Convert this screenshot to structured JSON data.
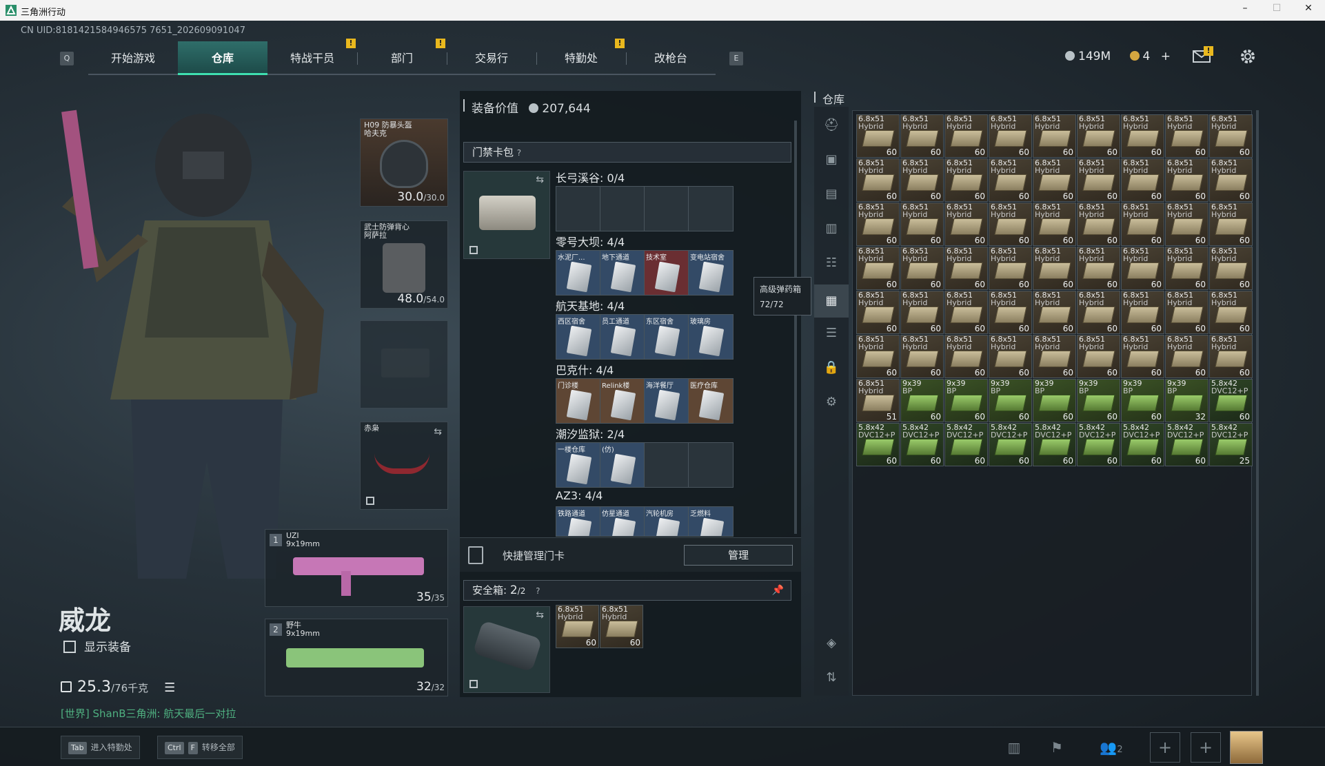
{
  "window": {
    "title": "三角洲行动",
    "minimize": "–",
    "maximize": "☐",
    "close": "✕"
  },
  "uid": "CN UID:8181421584946575 7651_202609091047",
  "nav": {
    "left_key": "Q",
    "right_key": "E",
    "tabs": [
      {
        "label": "开始游戏",
        "badge": ""
      },
      {
        "label": "仓库",
        "badge": ""
      },
      {
        "label": "特战干员",
        "badge": "!"
      },
      {
        "label": "部门",
        "badge": "!"
      },
      {
        "label": "交易行",
        "badge": ""
      },
      {
        "label": "特勤处",
        "badge": "!"
      },
      {
        "label": "改枪台",
        "badge": ""
      }
    ],
    "active_index": 1
  },
  "currency": {
    "silver": "149M",
    "gold": "4",
    "gold_plus": "+",
    "mail_badge": "!"
  },
  "character": {
    "name": "威龙",
    "show_equipment": "显示装备",
    "weight": "25.3",
    "weight_max": "/76千克"
  },
  "chat": {
    "text": "[世界] ShanB三角洲: 航天最后一对拉"
  },
  "equipment": {
    "helmet": {
      "label": "H09 防暴头盔\n哈夫克",
      "value": "30.0",
      "max": "/30.0"
    },
    "armor": {
      "label": "武士防弹背心\n阿萨拉",
      "value": "48.0",
      "max": "/54.0"
    },
    "melee": {
      "label": "赤枭"
    },
    "primary": {
      "slot": "1",
      "name": "UZI",
      "caliber": "9x19mm",
      "ammo": "35",
      "ammo_max": "/35"
    },
    "secondary": {
      "slot": "2",
      "name": "野牛",
      "caliber": "9x19mm",
      "ammo": "32",
      "ammo_max": "/32"
    }
  },
  "equip_value": {
    "label": "装备价值",
    "value": "207,644"
  },
  "keycard_pack": {
    "title": "门禁卡包",
    "help": "?",
    "groups": [
      {
        "title": "长弓溪谷: 0/4",
        "cards": []
      },
      {
        "title": "零号大坝: 4/4",
        "cards": [
          {
            "name": "水泥厂...",
            "type": "blue"
          },
          {
            "name": "地下通道",
            "type": "blue"
          },
          {
            "name": "技术室",
            "type": "red"
          },
          {
            "name": "变电站宿舍",
            "type": "blue"
          }
        ]
      },
      {
        "title": "航天基地: 4/4",
        "cards": [
          {
            "name": "西区宿舍",
            "type": "blue"
          },
          {
            "name": "员工通道",
            "type": "blue"
          },
          {
            "name": "东区宿舍",
            "type": "blue"
          },
          {
            "name": "玻璃房",
            "type": "blue"
          }
        ]
      },
      {
        "title": "巴克什: 4/4",
        "cards": [
          {
            "name": "门诊楼",
            "type": "brown"
          },
          {
            "name": "Relink楼",
            "type": "brown"
          },
          {
            "name": "海洋餐厅",
            "type": "blue"
          },
          {
            "name": "医疗仓库",
            "type": "brown"
          }
        ]
      },
      {
        "title": "潮汐监狱: 2/4",
        "cards": [
          {
            "name": "一楼仓库",
            "type": "blue"
          },
          {
            "name": "(仿)",
            "type": "blue"
          }
        ]
      },
      {
        "title": "AZ3: 4/4",
        "cards": [
          {
            "name": "铁路通道",
            "type": "blue"
          },
          {
            "name": "仿星通道",
            "type": "blue"
          },
          {
            "name": "汽轮机房",
            "type": "blue"
          },
          {
            "name": "乏燃料",
            "type": "blue"
          }
        ]
      }
    ]
  },
  "quick_manage": {
    "label": "快捷管理门卡",
    "button": "管理"
  },
  "safe_box": {
    "title": "安全箱",
    "count": "2",
    "capacity": "/2",
    "help": "?",
    "items": [
      {
        "name": "6.8x51",
        "sub": "Hybrid",
        "count": "60"
      },
      {
        "name": "6.8x51",
        "sub": "Hybrid",
        "count": "60"
      }
    ]
  },
  "tooltip": {
    "title": "高级弹药箱",
    "value": "72/72"
  },
  "warehouse": {
    "title": "仓库",
    "rows": [
      [
        {
          "n": "6.8x51",
          "s": "Hybrid",
          "c": "60",
          "t": 0
        },
        {
          "n": "6.8x51",
          "s": "Hybrid",
          "c": "60",
          "t": 0
        },
        {
          "n": "6.8x51",
          "s": "Hybrid",
          "c": "60",
          "t": 0
        },
        {
          "n": "6.8x51",
          "s": "Hybrid",
          "c": "60",
          "t": 0
        },
        {
          "n": "6.8x51",
          "s": "Hybrid",
          "c": "60",
          "t": 0
        },
        {
          "n": "6.8x51",
          "s": "Hybrid",
          "c": "60",
          "t": 0
        },
        {
          "n": "6.8x51",
          "s": "Hybrid",
          "c": "60",
          "t": 0
        },
        {
          "n": "6.8x51",
          "s": "Hybrid",
          "c": "60",
          "t": 0
        },
        {
          "n": "6.8x51",
          "s": "Hybrid",
          "c": "60",
          "t": 0
        }
      ],
      [
        {
          "n": "6.8x51",
          "s": "Hybrid",
          "c": "60",
          "t": 0
        },
        {
          "n": "6.8x51",
          "s": "Hybrid",
          "c": "60",
          "t": 0
        },
        {
          "n": "6.8x51",
          "s": "Hybrid",
          "c": "60",
          "t": 0
        },
        {
          "n": "6.8x51",
          "s": "Hybrid",
          "c": "60",
          "t": 0
        },
        {
          "n": "6.8x51",
          "s": "Hybrid",
          "c": "60",
          "t": 0
        },
        {
          "n": "6.8x51",
          "s": "Hybrid",
          "c": "60",
          "t": 0
        },
        {
          "n": "6.8x51",
          "s": "Hybrid",
          "c": "60",
          "t": 0
        },
        {
          "n": "6.8x51",
          "s": "Hybrid",
          "c": "60",
          "t": 0
        },
        {
          "n": "6.8x51",
          "s": "Hybrid",
          "c": "60",
          "t": 0
        }
      ],
      [
        {
          "n": "6.8x51",
          "s": "Hybrid",
          "c": "60",
          "t": 0
        },
        {
          "n": "6.8x51",
          "s": "Hybrid",
          "c": "60",
          "t": 0
        },
        {
          "n": "6.8x51",
          "s": "Hybrid",
          "c": "60",
          "t": 0
        },
        {
          "n": "6.8x51",
          "s": "Hybrid",
          "c": "60",
          "t": 0
        },
        {
          "n": "6.8x51",
          "s": "Hybrid",
          "c": "60",
          "t": 0
        },
        {
          "n": "6.8x51",
          "s": "Hybrid",
          "c": "60",
          "t": 0
        },
        {
          "n": "6.8x51",
          "s": "Hybrid",
          "c": "60",
          "t": 0
        },
        {
          "n": "6.8x51",
          "s": "Hybrid",
          "c": "60",
          "t": 0
        },
        {
          "n": "6.8x51",
          "s": "Hybrid",
          "c": "60",
          "t": 0
        }
      ],
      [
        {
          "n": "6.8x51",
          "s": "Hybrid",
          "c": "60",
          "t": 0
        },
        {
          "n": "6.8x51",
          "s": "Hybrid",
          "c": "60",
          "t": 0
        },
        {
          "n": "6.8x51",
          "s": "Hybrid",
          "c": "60",
          "t": 0
        },
        {
          "n": "6.8x51",
          "s": "Hybrid",
          "c": "60",
          "t": 0
        },
        {
          "n": "6.8x51",
          "s": "Hybrid",
          "c": "60",
          "t": 0
        },
        {
          "n": "6.8x51",
          "s": "Hybrid",
          "c": "60",
          "t": 0
        },
        {
          "n": "6.8x51",
          "s": "Hybrid",
          "c": "60",
          "t": 0
        },
        {
          "n": "6.8x51",
          "s": "Hybrid",
          "c": "60",
          "t": 0
        },
        {
          "n": "6.8x51",
          "s": "Hybrid",
          "c": "60",
          "t": 0
        }
      ],
      [
        {
          "n": "6.8x51",
          "s": "Hybrid",
          "c": "60",
          "t": 0
        },
        {
          "n": "6.8x51",
          "s": "Hybrid",
          "c": "60",
          "t": 0
        },
        {
          "n": "6.8x51",
          "s": "Hybrid",
          "c": "60",
          "t": 0
        },
        {
          "n": "6.8x51",
          "s": "Hybrid",
          "c": "60",
          "t": 0
        },
        {
          "n": "6.8x51",
          "s": "Hybrid",
          "c": "60",
          "t": 0
        },
        {
          "n": "6.8x51",
          "s": "Hybrid",
          "c": "60",
          "t": 0
        },
        {
          "n": "6.8x51",
          "s": "Hybrid",
          "c": "60",
          "t": 0
        },
        {
          "n": "6.8x51",
          "s": "Hybrid",
          "c": "60",
          "t": 0
        },
        {
          "n": "6.8x51",
          "s": "Hybrid",
          "c": "60",
          "t": 0
        }
      ],
      [
        {
          "n": "6.8x51",
          "s": "Hybrid",
          "c": "60",
          "t": 0
        },
        {
          "n": "6.8x51",
          "s": "Hybrid",
          "c": "60",
          "t": 0
        },
        {
          "n": "6.8x51",
          "s": "Hybrid",
          "c": "60",
          "t": 0
        },
        {
          "n": "6.8x51",
          "s": "Hybrid",
          "c": "60",
          "t": 0
        },
        {
          "n": "6.8x51",
          "s": "Hybrid",
          "c": "60",
          "t": 0
        },
        {
          "n": "6.8x51",
          "s": "Hybrid",
          "c": "60",
          "t": 0
        },
        {
          "n": "6.8x51",
          "s": "Hybrid",
          "c": "60",
          "t": 0
        },
        {
          "n": "6.8x51",
          "s": "Hybrid",
          "c": "60",
          "t": 0
        },
        {
          "n": "6.8x51",
          "s": "Hybrid",
          "c": "60",
          "t": 0
        }
      ],
      [
        {
          "n": "6.8x51",
          "s": "Hybrid",
          "c": "51",
          "t": 0
        },
        {
          "n": "9x39",
          "s": "BP",
          "c": "60",
          "t": 1
        },
        {
          "n": "9x39",
          "s": "BP",
          "c": "60",
          "t": 1
        },
        {
          "n": "9x39",
          "s": "BP",
          "c": "60",
          "t": 1
        },
        {
          "n": "9x39",
          "s": "BP",
          "c": "60",
          "t": 1
        },
        {
          "n": "9x39",
          "s": "BP",
          "c": "60",
          "t": 1
        },
        {
          "n": "9x39",
          "s": "BP",
          "c": "60",
          "t": 1
        },
        {
          "n": "9x39",
          "s": "BP",
          "c": "32",
          "t": 1
        },
        {
          "n": "5.8x42",
          "s": "DVC12+P",
          "c": "60",
          "t": 2
        }
      ],
      [
        {
          "n": "5.8x42",
          "s": "DVC12+P",
          "c": "60",
          "t": 2
        },
        {
          "n": "5.8x42",
          "s": "DVC12+P",
          "c": "60",
          "t": 2
        },
        {
          "n": "5.8x42",
          "s": "DVC12+P",
          "c": "60",
          "t": 2
        },
        {
          "n": "5.8x42",
          "s": "DVC12+P",
          "c": "60",
          "t": 2
        },
        {
          "n": "5.8x42",
          "s": "DVC12+P",
          "c": "60",
          "t": 2
        },
        {
          "n": "5.8x42",
          "s": "DVC12+P",
          "c": "60",
          "t": 2
        },
        {
          "n": "5.8x42",
          "s": "DVC12+P",
          "c": "60",
          "t": 2
        },
        {
          "n": "5.8x42",
          "s": "DVC12+P",
          "c": "60",
          "t": 2
        },
        {
          "n": "5.8x42",
          "s": "DVC12+P",
          "c": "25",
          "t": 2
        }
      ]
    ]
  },
  "bottom": {
    "tab_key": "Tab",
    "tab_label": "进入特勤处",
    "ctrl_key": "Ctrl",
    "f_key": "F",
    "transfer_label": "转移全部",
    "team_count": "2"
  },
  "colors": {
    "accent": "#3fe0b0",
    "badge": "#e9b81e",
    "chat": "#4fb080"
  }
}
